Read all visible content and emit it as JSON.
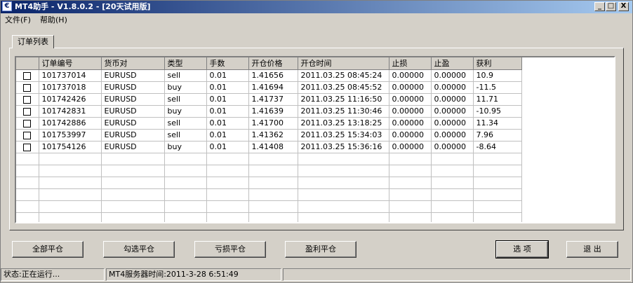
{
  "window": {
    "title": "MT4助手 - V1.8.0.2 - [20天试用版]",
    "minimize": "_",
    "maximize": "□",
    "close": "X",
    "app_icon": "app-logo-icon"
  },
  "menu": {
    "items": [
      {
        "label": "文件(F)"
      },
      {
        "label": "帮助(H)"
      }
    ]
  },
  "tabs": [
    {
      "label": "订单列表"
    }
  ],
  "table": {
    "columns": [
      "订单编号",
      "货币对",
      "类型",
      "手数",
      "开仓价格",
      "开仓时间",
      "止损",
      "止盈",
      "获利"
    ],
    "rows": [
      [
        "101737014",
        "EURUSD",
        "sell",
        "0.01",
        "1.41656",
        "2011.03.25 08:45:24",
        "0.00000",
        "0.00000",
        "10.9"
      ],
      [
        "101737018",
        "EURUSD",
        "buy",
        "0.01",
        "1.41694",
        "2011.03.25 08:45:52",
        "0.00000",
        "0.00000",
        "-11.5"
      ],
      [
        "101742426",
        "EURUSD",
        "sell",
        "0.01",
        "1.41737",
        "2011.03.25 11:16:50",
        "0.00000",
        "0.00000",
        "11.71"
      ],
      [
        "101742831",
        "EURUSD",
        "buy",
        "0.01",
        "1.41639",
        "2011.03.25 11:30:46",
        "0.00000",
        "0.00000",
        "-10.95"
      ],
      [
        "101742886",
        "EURUSD",
        "sell",
        "0.01",
        "1.41700",
        "2011.03.25 13:18:25",
        "0.00000",
        "0.00000",
        "11.34"
      ],
      [
        "101753997",
        "EURUSD",
        "sell",
        "0.01",
        "1.41362",
        "2011.03.25 15:34:03",
        "0.00000",
        "0.00000",
        "7.96"
      ],
      [
        "101754126",
        "EURUSD",
        "buy",
        "0.01",
        "1.41408",
        "2011.03.25 15:36:16",
        "0.00000",
        "0.00000",
        "-8.64"
      ]
    ]
  },
  "buttons": {
    "close_all": "全部平仓",
    "close_checked": "勾选平仓",
    "close_losing": "亏损平仓",
    "close_profit": "盈利平仓",
    "options": "选 项",
    "exit": "退 出"
  },
  "status": {
    "state": "状态:正在运行...",
    "server_time": "MT4服务器时间:2011-3-28 6:51:49",
    "extra": ""
  }
}
